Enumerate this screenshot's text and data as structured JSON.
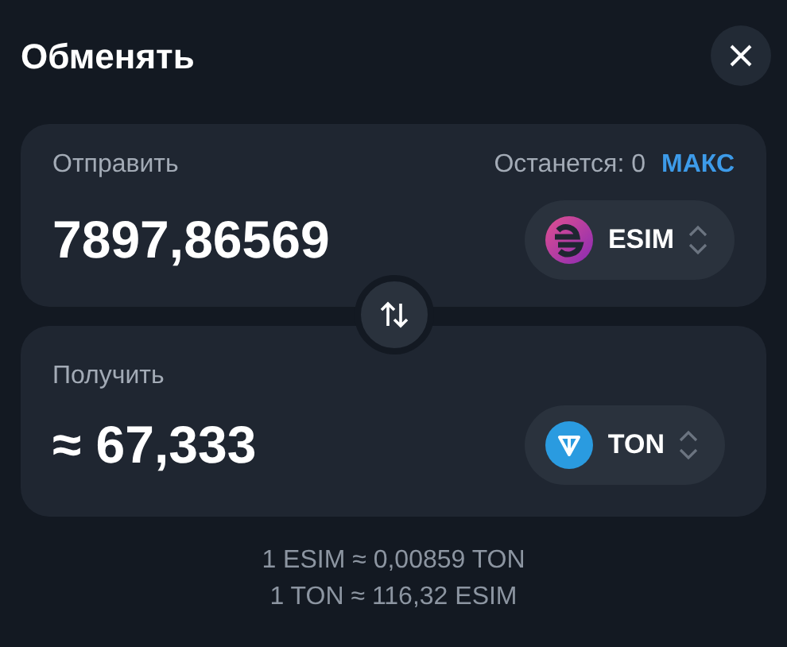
{
  "header": {
    "title": "Обменять"
  },
  "send": {
    "label": "Отправить",
    "remaining": "Останется: 0",
    "max": "МАКС",
    "amount": "7897,86569",
    "token": {
      "symbol": "ESIM",
      "kind": "esim"
    }
  },
  "receive": {
    "label": "Получить",
    "amount": "≈ 67,333",
    "token": {
      "symbol": "TON",
      "kind": "ton"
    }
  },
  "rates": [
    "1 ESIM ≈ 0,00859 TON",
    "1 TON ≈ 116,32 ESIM"
  ]
}
